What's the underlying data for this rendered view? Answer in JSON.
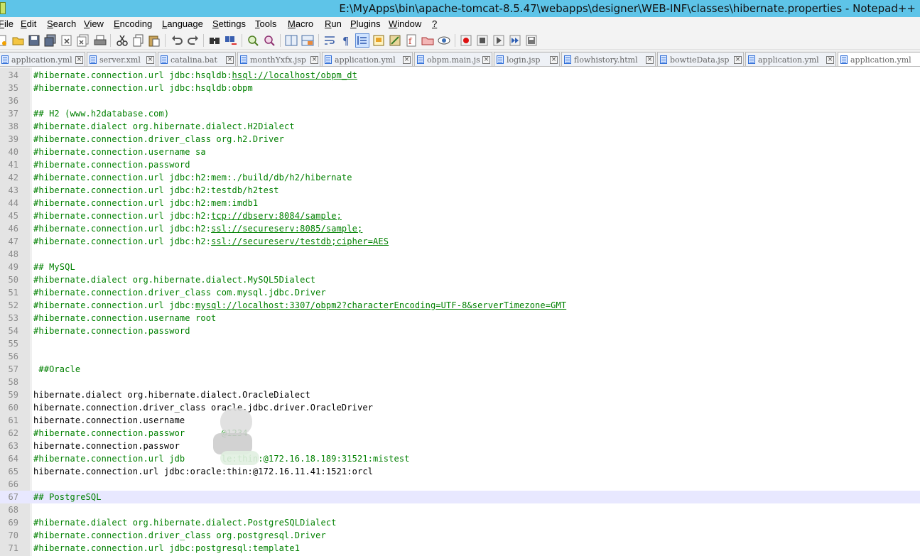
{
  "window": {
    "title": "E:\\MyApps\\bin\\apache-tomcat-8.5.47\\webapps\\designer\\WEB-INF\\classes\\hibernate.properties - Notepad++"
  },
  "menu": [
    {
      "label": "File"
    },
    {
      "label": "Edit"
    },
    {
      "label": "Search"
    },
    {
      "label": "View"
    },
    {
      "label": "Encoding"
    },
    {
      "label": "Language"
    },
    {
      "label": "Settings"
    },
    {
      "label": "Tools"
    },
    {
      "label": "Macro"
    },
    {
      "label": "Run"
    },
    {
      "label": "Plugins"
    },
    {
      "label": "Window"
    },
    {
      "label": "?"
    }
  ],
  "toolbar_icons": [
    "new-file-icon",
    "open-file-icon",
    "save-icon",
    "save-all-icon",
    "close-icon",
    "close-all-icon",
    "print-icon",
    "cut-icon",
    "copy-icon",
    "paste-icon",
    "undo-icon",
    "redo-icon",
    "find-icon",
    "replace-icon",
    "zoom-in-icon",
    "zoom-out-icon",
    "sync-vertical-icon",
    "sync-horizontal-icon",
    "word-wrap-icon",
    "show-all-chars-icon",
    "indent-guide-icon",
    "doc-map-icon",
    "function-list-icon",
    "folder-workspace-icon",
    "monitoring-icon",
    "record-macro-icon",
    "stop-macro-icon",
    "play-macro-icon",
    "run-macro-multiple-icon",
    "save-macro-icon"
  ],
  "tabs": [
    {
      "label": "application.yml"
    },
    {
      "label": "server.xml"
    },
    {
      "label": "catalina.bat"
    },
    {
      "label": "monthYxfx.jsp"
    },
    {
      "label": "application.yml"
    },
    {
      "label": "obpm.main.js"
    },
    {
      "label": "login.jsp"
    },
    {
      "label": "flowhistory.html"
    },
    {
      "label": "bowtieData.jsp"
    },
    {
      "label": "application.yml"
    },
    {
      "label": "application.yml"
    }
  ],
  "editor": {
    "current_line": 67,
    "lines": [
      {
        "n": "34",
        "parts": [
          {
            "t": "#hibernate.connection.url jdbc:hsqldb:",
            "s": "comment"
          },
          {
            "t": "hsql://localhost/obpm_dt",
            "s": "link"
          }
        ]
      },
      {
        "n": "35",
        "parts": [
          {
            "t": "#hibernate.connection.url jdbc:hsqldb:obpm",
            "s": "comment"
          }
        ]
      },
      {
        "n": "36",
        "parts": []
      },
      {
        "n": "37",
        "parts": [
          {
            "t": "## H2 (www.h2database.com)",
            "s": "comment"
          }
        ]
      },
      {
        "n": "38",
        "parts": [
          {
            "t": "#hibernate.dialect org.hibernate.dialect.H2Dialect",
            "s": "comment"
          }
        ]
      },
      {
        "n": "39",
        "parts": [
          {
            "t": "#hibernate.connection.driver_class org.h2.Driver",
            "s": "comment"
          }
        ]
      },
      {
        "n": "40",
        "parts": [
          {
            "t": "#hibernate.connection.username sa",
            "s": "comment"
          }
        ]
      },
      {
        "n": "41",
        "parts": [
          {
            "t": "#hibernate.connection.password",
            "s": "comment"
          }
        ]
      },
      {
        "n": "42",
        "parts": [
          {
            "t": "#hibernate.connection.url jdbc:h2:mem:./build/db/h2/hibernate",
            "s": "comment"
          }
        ]
      },
      {
        "n": "43",
        "parts": [
          {
            "t": "#hibernate.connection.url jdbc:h2:testdb/h2test",
            "s": "comment"
          }
        ]
      },
      {
        "n": "44",
        "parts": [
          {
            "t": "#hibernate.connection.url jdbc:h2:mem:imdb1",
            "s": "comment"
          }
        ]
      },
      {
        "n": "45",
        "parts": [
          {
            "t": "#hibernate.connection.url jdbc:h2:",
            "s": "comment"
          },
          {
            "t": "tcp://dbserv:8084/sample;",
            "s": "link"
          }
        ]
      },
      {
        "n": "46",
        "parts": [
          {
            "t": "#hibernate.connection.url jdbc:h2:",
            "s": "comment"
          },
          {
            "t": "ssl://secureserv:8085/sample;",
            "s": "link"
          }
        ]
      },
      {
        "n": "47",
        "parts": [
          {
            "t": "#hibernate.connection.url jdbc:h2:",
            "s": "comment"
          },
          {
            "t": "ssl://secureserv/testdb;cipher=AES",
            "s": "link"
          }
        ]
      },
      {
        "n": "48",
        "parts": []
      },
      {
        "n": "49",
        "parts": [
          {
            "t": "## MySQL",
            "s": "comment"
          }
        ]
      },
      {
        "n": "50",
        "parts": [
          {
            "t": "#hibernate.dialect org.hibernate.dialect.MySQL5Dialect",
            "s": "comment"
          }
        ]
      },
      {
        "n": "51",
        "parts": [
          {
            "t": "#hibernate.connection.driver_class com.mysql.jdbc.Driver",
            "s": "comment"
          }
        ]
      },
      {
        "n": "52",
        "parts": [
          {
            "t": "#hibernate.connection.url jdbc:",
            "s": "comment"
          },
          {
            "t": "mysql://localhost:3307/obpm2?characterEncoding=UTF-8&serverTimezone=GMT",
            "s": "link"
          }
        ]
      },
      {
        "n": "53",
        "parts": [
          {
            "t": "#hibernate.connection.username root",
            "s": "comment"
          }
        ]
      },
      {
        "n": "54",
        "parts": [
          {
            "t": "#hibernate.connection.password",
            "s": "comment"
          }
        ]
      },
      {
        "n": "55",
        "parts": []
      },
      {
        "n": "56",
        "parts": []
      },
      {
        "n": "57",
        "parts": [
          {
            "t": " ##Oracle",
            "s": "comment"
          }
        ]
      },
      {
        "n": "58",
        "parts": []
      },
      {
        "n": "59",
        "parts": [
          {
            "t": "hibernate.dialect org.hibernate.dialect.OracleDialect",
            "s": "plain"
          }
        ]
      },
      {
        "n": "60",
        "parts": [
          {
            "t": "hibernate.connection.driver_class oracle.jdbc.driver.OracleDriver",
            "s": "plain"
          }
        ]
      },
      {
        "n": "61",
        "parts": [
          {
            "t": "hibernate.connection.username",
            "s": "plain"
          }
        ]
      },
      {
        "n": "62",
        "parts": [
          {
            "t": "#hibernate.connection.passwor",
            "s": "comment"
          },
          {
            "t": "       @1234",
            "s": "comment"
          }
        ]
      },
      {
        "n": "63",
        "parts": [
          {
            "t": "hibernate.connection.passwor",
            "s": "plain"
          }
        ]
      },
      {
        "n": "64",
        "parts": [
          {
            "t": "#hibernate.connection.url jdb",
            "s": "comment"
          },
          {
            "t": "       le:thin:@172.16.18.189:31521:mistest",
            "s": "comment"
          }
        ]
      },
      {
        "n": "65",
        "parts": [
          {
            "t": "hibernate.connection.url jdbc:oracle:thin:@172.16.11.41:1521:orcl",
            "s": "plain"
          }
        ]
      },
      {
        "n": "66",
        "parts": []
      },
      {
        "n": "67",
        "parts": [
          {
            "t": "## PostgreSQL",
            "s": "comment"
          }
        ]
      },
      {
        "n": "68",
        "parts": []
      },
      {
        "n": "69",
        "parts": [
          {
            "t": "#hibernate.dialect org.hibernate.dialect.PostgreSQLDialect",
            "s": "comment"
          }
        ]
      },
      {
        "n": "70",
        "parts": [
          {
            "t": "#hibernate.connection.driver_class org.postgresql.Driver",
            "s": "comment"
          }
        ]
      },
      {
        "n": "71",
        "parts": [
          {
            "t": "#hibernate.connection.url jdbc:postgresql:template1",
            "s": "comment"
          }
        ]
      }
    ]
  }
}
